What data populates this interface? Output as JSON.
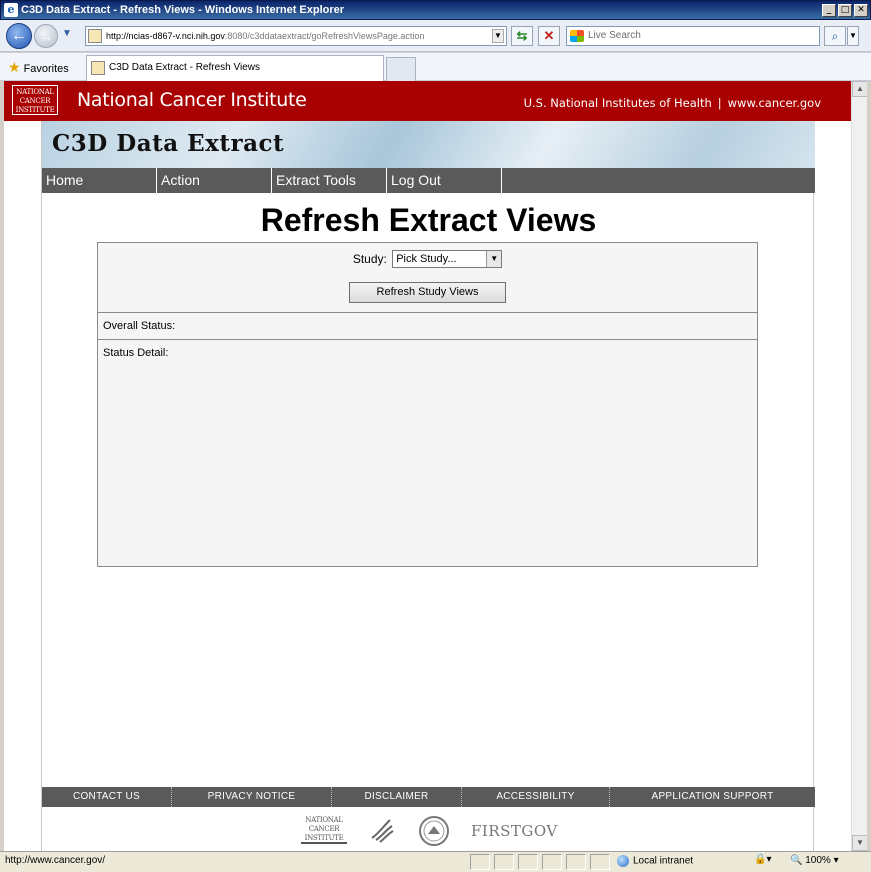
{
  "window": {
    "title": "C3D Data Extract - Refresh Views - Windows Internet Explorer",
    "controls": [
      "_",
      "□",
      "✕"
    ]
  },
  "browser": {
    "address_host": "http://ncias-d867-v.nci.nih.gov",
    "address_path": ":8080/c3ddataextract/goRefreshViewsPage.action",
    "search_placeholder": "Live Search",
    "favorites_label": "Favorites",
    "tab_title": "C3D Data Extract - Refresh Views"
  },
  "banner": {
    "logo_text": [
      "NATIONAL",
      "CANCER",
      "INSTITUTE"
    ],
    "name": "National Cancer Institute",
    "link_nih": "U.S. National Institutes of Health",
    "separator": "|",
    "link_cancer_gov": "www.cancer.gov"
  },
  "app": {
    "title": "C3D Data Extract",
    "menu": [
      "Home",
      "Action",
      "Extract Tools",
      "Log Out"
    ]
  },
  "main": {
    "page_title": "Refresh Extract Views",
    "study_label": "Study:",
    "study_selected": "Pick Study...",
    "refresh_button": "Refresh Study Views",
    "overall_status_label": "Overall Status:",
    "status_detail_label": "Status Detail:"
  },
  "footer": {
    "links": [
      "CONTACT US",
      "PRIVACY NOTICE",
      "DISCLAIMER",
      "ACCESSIBILITY",
      "APPLICATION SUPPORT"
    ],
    "nci_logo_text": [
      "NATIONAL",
      "CANCER",
      "INSTITUTE"
    ],
    "firstgov": "FIRSTGOV"
  },
  "statusbar": {
    "url": "http://www.cancer.gov/",
    "zone": "Local intranet",
    "zoom": "100%"
  },
  "colors": {
    "nci_red": "#a90101",
    "menu_gray": "#5a5a5a"
  }
}
